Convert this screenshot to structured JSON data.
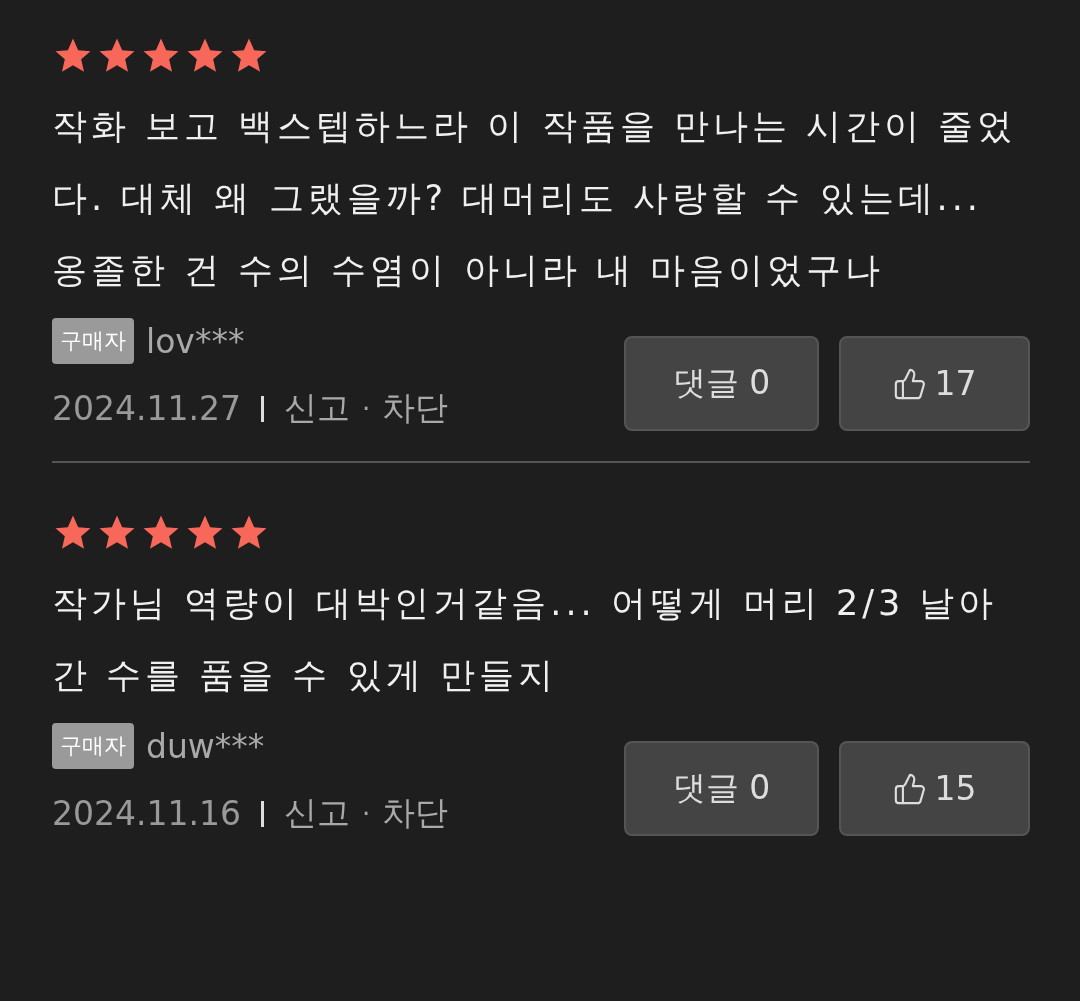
{
  "reviews": [
    {
      "stars": 5,
      "text": "작화 보고 백스텝하느라 이 작품을 만나는 시간이 줄었다. 대체 왜 그랬을까? 대머리도 사랑할 수 있는데... 옹졸한 건 수의 수염이 아니라 내 마음이었구나",
      "badge": "구매자",
      "user": "lov***",
      "date": "2024.11.27",
      "actions": [
        "신고",
        "차단"
      ],
      "separator": "·",
      "comment_button": "댓글 0",
      "likes": "17"
    },
    {
      "stars": 5,
      "text": "작가님 역량이 대박인거같음... 어떻게 머리 2/3 날아간 수를 품을 수 있게 만들지",
      "badge": "구매자",
      "user": "duw***",
      "date": "2024.11.16",
      "actions": [
        "신고",
        "차단"
      ],
      "separator": "·",
      "comment_button": "댓글 0",
      "likes": "15"
    }
  ]
}
